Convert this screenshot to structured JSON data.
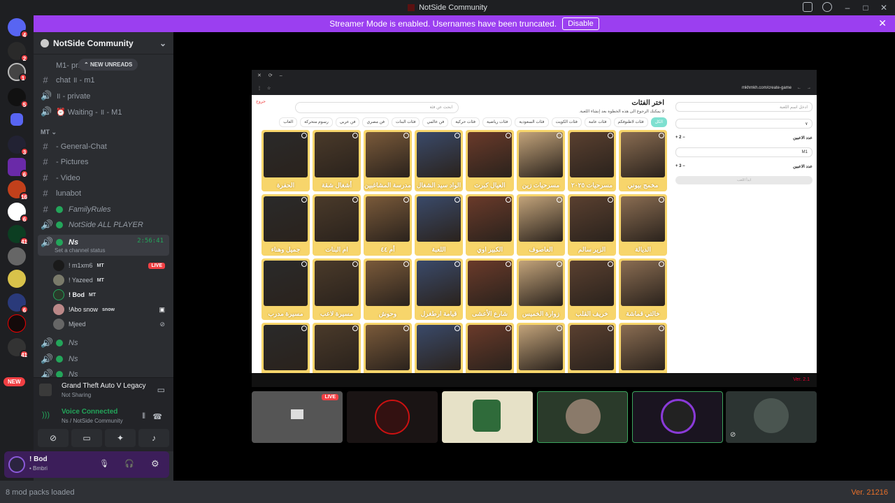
{
  "window": {
    "title": "NotSide Community"
  },
  "banner": {
    "text": "Streamer Mode is enabled. Usernames have been truncated.",
    "button": "Disable"
  },
  "guilds": {
    "badges": [
      "4",
      "2",
      "1",
      "5",
      "3",
      "6",
      "16",
      "6",
      "41",
      "6",
      "41"
    ],
    "new_label": "NEW"
  },
  "server": {
    "name": "NotSide Community",
    "new_unreads": "NEW UNREADS"
  },
  "channels": [
    {
      "icon": "hash",
      "label": "M1- private"
    },
    {
      "icon": "hash",
      "label": "chat ॥ - m1"
    },
    {
      "icon": "speaker",
      "label": "॥ - private"
    },
    {
      "icon": "speaker",
      "label": "⏰ Waiting - ॥ - M1"
    }
  ],
  "category": "MT",
  "channels2": [
    {
      "icon": "hash",
      "label": "- General-Chat"
    },
    {
      "icon": "hash",
      "label": "- Pictures"
    },
    {
      "icon": "hash",
      "label": "- Video"
    },
    {
      "icon": "hash",
      "label": "lunabot"
    },
    {
      "icon": "hash",
      "label": "FamilyRules"
    },
    {
      "icon": "speaker",
      "label": "NotSide ALL PLAYER"
    }
  ],
  "active_vc": {
    "name": "Ns",
    "timer": "2:56:41",
    "status": "Set a channel status"
  },
  "vc_users": [
    {
      "name": "! m1xm6",
      "tag": "MT",
      "live": "LIVE"
    },
    {
      "name": "! Yazeed",
      "tag": "MT"
    },
    {
      "name": "! Bod",
      "tag": "MT"
    },
    {
      "name": "!Abo snow",
      "tag": "snow"
    },
    {
      "name": "Mjeed",
      "tag": ""
    }
  ],
  "other_vcs": [
    "Ns",
    "Ns",
    "Ns"
  ],
  "activity": {
    "game": "Grand Theft Auto V Legacy",
    "status": "Not Sharing"
  },
  "voice": {
    "title": "Voice Connected",
    "channel": "Ns / NotSide Community"
  },
  "me": {
    "name": "! Bod",
    "sub": "• Bmbri"
  },
  "stream": {
    "url": "mkhmkh.com/create-game",
    "page_title": "اختر الفئات",
    "page_sub": "لا يمكنك الرجوع الى هذه الخطوة بعد إنشاء اللعبة.",
    "search": "ابحث عن فئة",
    "exit": "خروج",
    "categories": [
      "الكل",
      "فئات لاطنوفكم",
      "فئات عامة",
      "فئات الكويت",
      "فئات السعودية",
      "فئات رياضية",
      "فئات حركية",
      "فن عالمي",
      "فئات البنات",
      "فن مصري",
      "فن عربي",
      "رسوم متحركة",
      "العاب"
    ],
    "cards": [
      "مخمج بيوني",
      "مسرحيات ٢٠٢٥",
      "مسرحيات زين",
      "العيال كبرت",
      "الواد سيد الشغال",
      "مدرسة المشاغبين",
      "أشغال شقة",
      "الحفرة",
      "الديالة",
      "الزير سالم",
      "العاصوف",
      "الكبير اوي",
      "اللعبة",
      "أم ٤٤",
      "ام البنات",
      "جميل وهناء",
      "خالتي قماشة",
      "خريف القلب",
      "زوارة الخميس",
      "شارع الأعشى",
      "قيامة ارطغرل",
      "وحوش",
      "مسيرة لاعب",
      "مسيرة مدرب",
      "",
      "",
      "",
      "",
      "",
      "",
      "",
      ""
    ],
    "form": {
      "name_placeholder": "ادخل اسم اللعبة",
      "players_label": "عدد الاعبين",
      "count1": "2",
      "team": "M1",
      "count2": "3",
      "start": "ابدأ اللعب",
      "version": "Ver. 2.1"
    }
  },
  "footer": {
    "left": "8 mod packs loaded",
    "right": "Ver. 21216"
  }
}
